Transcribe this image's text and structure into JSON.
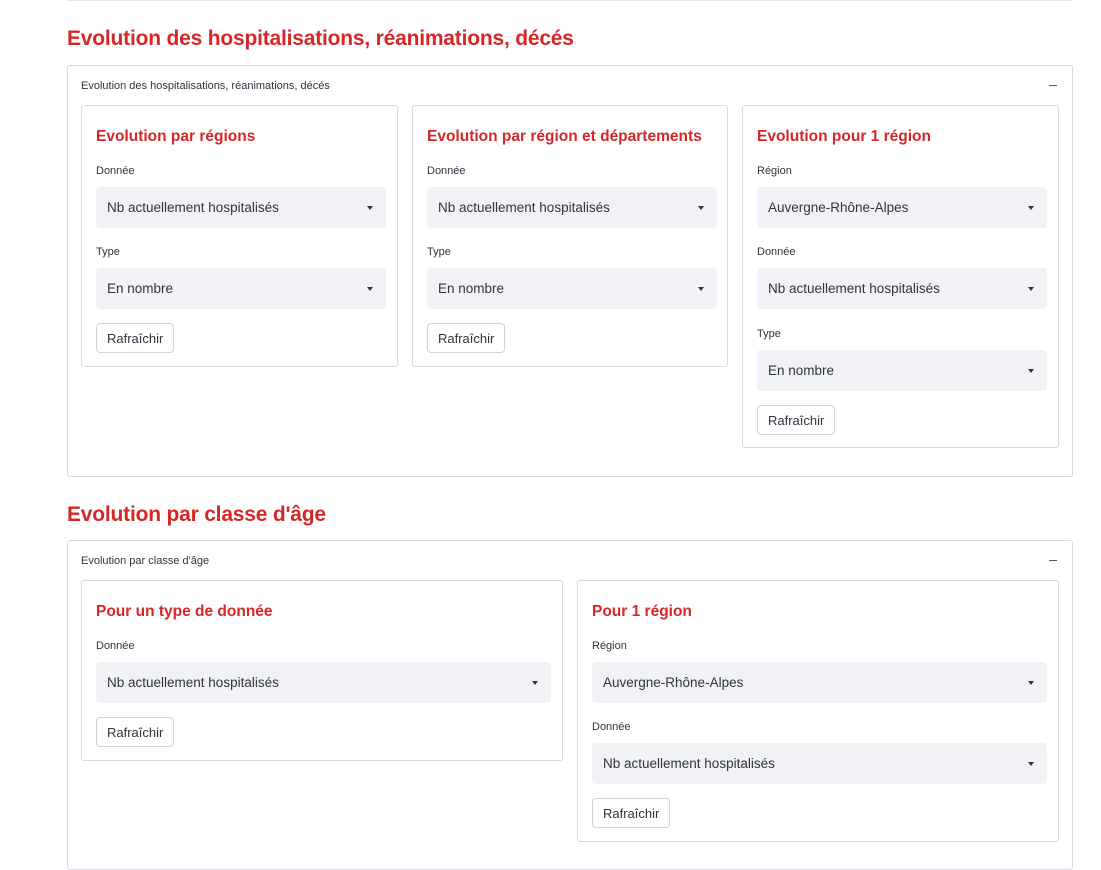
{
  "sections": {
    "hosp": {
      "title": "Evolution des hospitalisations, réanimations, décés",
      "expander_label": "Evolution des hospitalisations, réanimations, décés",
      "cards": {
        "regions": {
          "title": "Evolution par régions",
          "donnee_label": "Donnée",
          "donnee_value": "Nb actuellement hospitalisés",
          "type_label": "Type",
          "type_value": "En nombre",
          "refresh_label": "Rafraîchir"
        },
        "departements": {
          "title": "Evolution par région et départements",
          "donnee_label": "Donnée",
          "donnee_value": "Nb actuellement hospitalisés",
          "type_label": "Type",
          "type_value": "En nombre",
          "refresh_label": "Rafraîchir"
        },
        "une_region": {
          "title": "Evolution pour 1 région",
          "region_label": "Région",
          "region_value": "Auvergne-Rhône-Alpes",
          "donnee_label": "Donnée",
          "donnee_value": "Nb actuellement hospitalisés",
          "type_label": "Type",
          "type_value": "En nombre",
          "refresh_label": "Rafraîchir"
        }
      }
    },
    "age": {
      "title": "Evolution par classe d'âge",
      "expander_label": "Evolution par classe d'âge",
      "cards": {
        "type_donnee": {
          "title": "Pour un type de donnée",
          "donnee_label": "Donnée",
          "donnee_value": "Nb actuellement hospitalisés",
          "refresh_label": "Rafraîchir"
        },
        "une_region": {
          "title": "Pour 1 région",
          "region_label": "Région",
          "region_value": "Auvergne-Rhône-Alpes",
          "donnee_label": "Donnée",
          "donnee_value": "Nb actuellement hospitalisés",
          "refresh_label": "Rafraîchir"
        }
      }
    }
  },
  "icons": {
    "collapse": "minus-icon",
    "dropdown": "caret-down-icon"
  },
  "colors": {
    "accent_title": "#d62728",
    "select_bg": "#f0f2f6",
    "border": "#d9dadf"
  }
}
